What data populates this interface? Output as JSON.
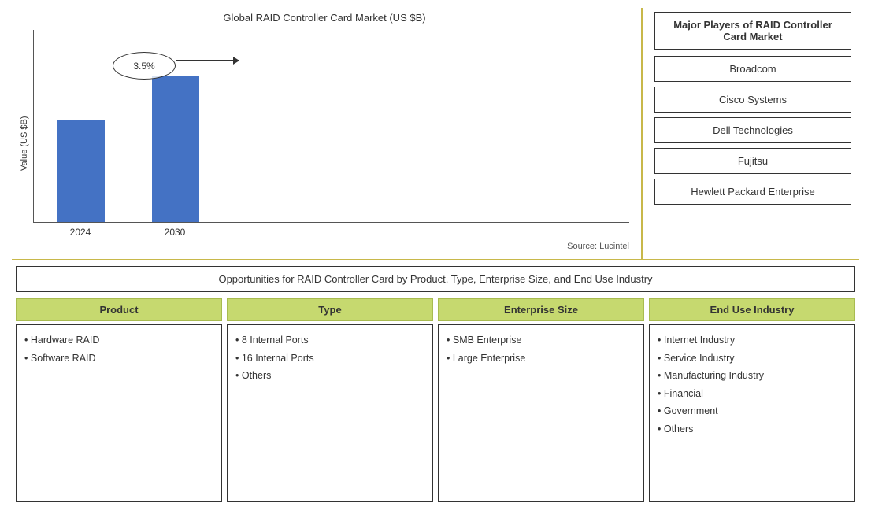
{
  "chart": {
    "title": "Global RAID Controller Card Market (US $B)",
    "y_axis_label": "Value (US $B)",
    "source": "Source: Lucintel",
    "annotation_label": "3.5%",
    "bars": [
      {
        "year": "2024",
        "height": 130
      },
      {
        "year": "2030",
        "height": 185
      }
    ]
  },
  "major_players": {
    "title": "Major Players of RAID Controller Card Market",
    "players": [
      "Broadcom",
      "Cisco Systems",
      "Dell Technologies",
      "Fujitsu",
      "Hewlett Packard Enterprise"
    ]
  },
  "opportunities": {
    "title": "Opportunities for RAID Controller Card by Product, Type, Enterprise Size, and End Use Industry",
    "columns": [
      {
        "header": "Product",
        "items": [
          "Hardware RAID",
          "Software RAID"
        ]
      },
      {
        "header": "Type",
        "items": [
          "8 Internal Ports",
          "16 Internal Ports",
          "Others"
        ]
      },
      {
        "header": "Enterprise Size",
        "items": [
          "SMB Enterprise",
          "Large Enterprise"
        ]
      },
      {
        "header": "End Use Industry",
        "items": [
          "Internet Industry",
          "Service Industry",
          "Manufacturing Industry",
          "Financial",
          "Government",
          "Others"
        ]
      }
    ]
  }
}
